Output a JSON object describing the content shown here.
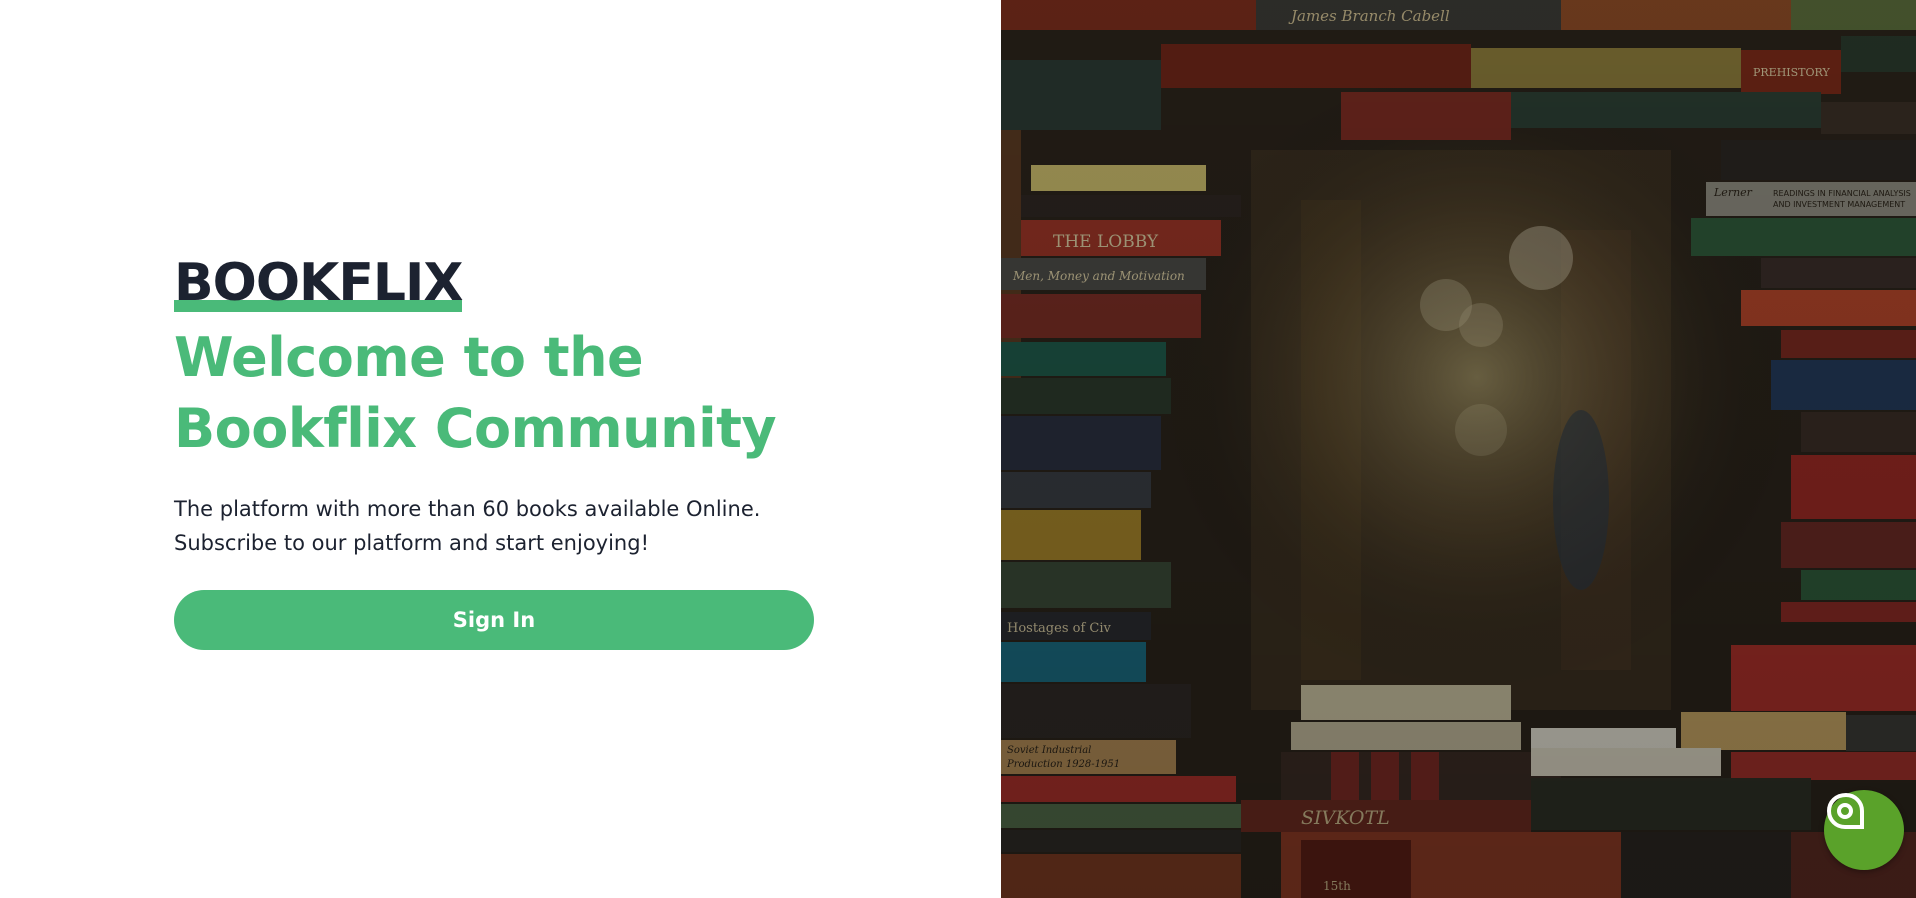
{
  "hero": {
    "brand": "BOOKFLIX",
    "headline_line1": "Welcome to the",
    "headline_line2": "Bookflix Community",
    "description_line1": "The platform with more than 60 books available Online.",
    "description_line2": "Subscribe to our platform and start enjoying!",
    "signin_label": "Sign In"
  },
  "image": {
    "book_titles": [
      "James Branch Cabell",
      "PREHISTORY",
      "THE LOBBY",
      "Men, Money and Motivation",
      "Hostages of Civilization",
      "READINGS IN FINANCIAL ANALYSIS AND INVESTMENT MANAGEMENT",
      "Soviet Industrial Production 1928-1951",
      "15th"
    ]
  },
  "chat": {
    "icon": "chat-bubble-icon"
  },
  "colors": {
    "accent": "#4aba79",
    "text_dark": "#1c2230",
    "chat_button": "#5aa22a"
  }
}
